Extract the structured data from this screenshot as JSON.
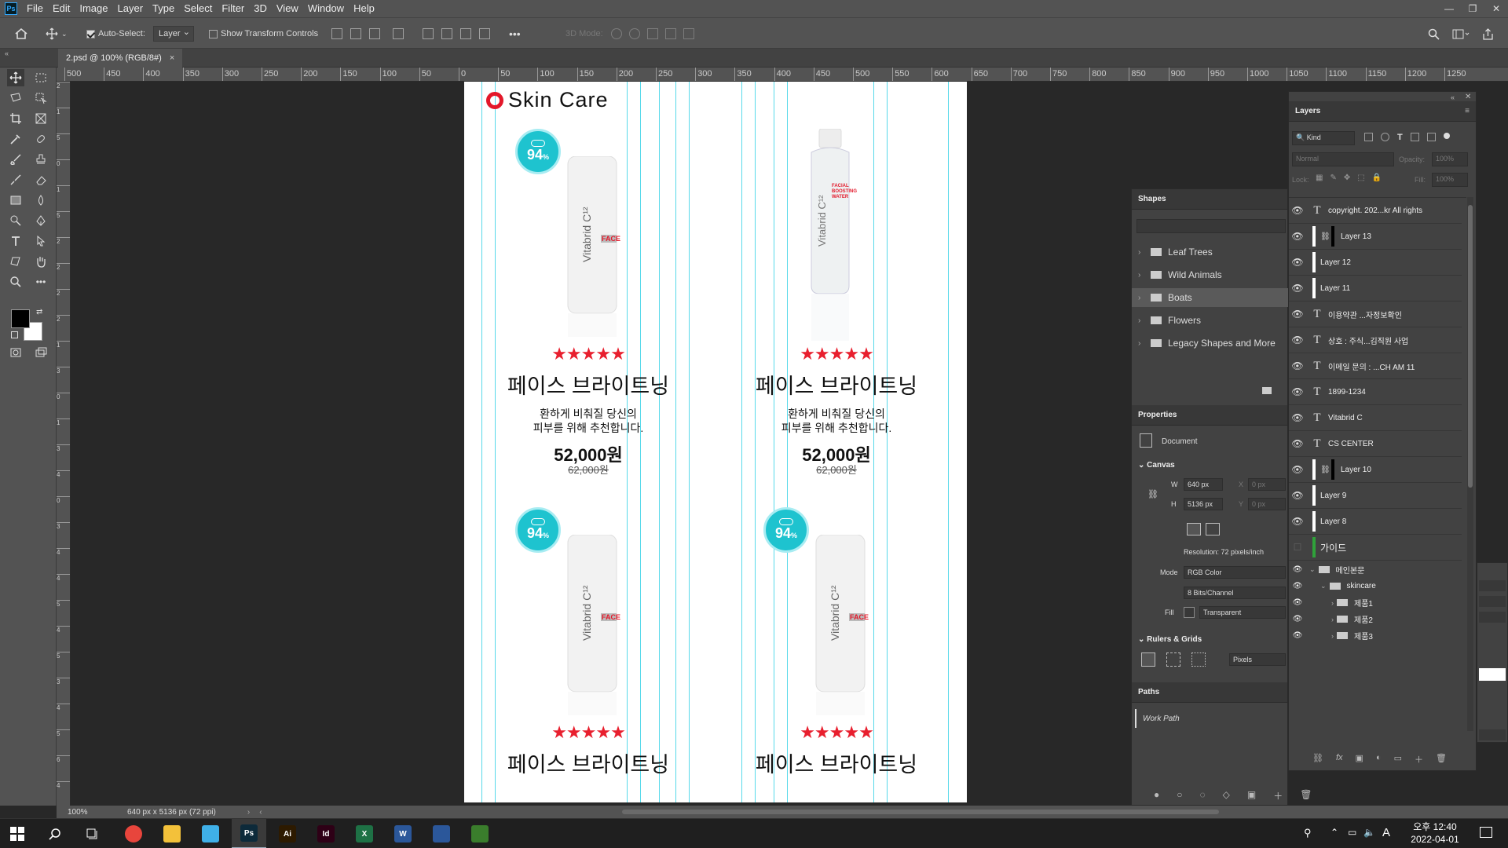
{
  "menu": [
    "File",
    "Edit",
    "Image",
    "Layer",
    "Type",
    "Select",
    "Filter",
    "3D",
    "View",
    "Window",
    "Help"
  ],
  "app_logo": "Ps",
  "options": {
    "auto_select_label": "Auto-Select:",
    "layer_select": "Layer",
    "show_transform_label": "Show Transform Controls",
    "mode_3d_label": "3D Mode:"
  },
  "doc_tab": {
    "title": "2.psd @ 100% (RGB/8#)",
    "close": "×"
  },
  "ruler_h": [
    "500",
    "450",
    "400",
    "350",
    "300",
    "250",
    "200",
    "150",
    "100",
    "50",
    "0",
    "50",
    "100",
    "150",
    "200",
    "250",
    "300",
    "350",
    "400",
    "450",
    "500",
    "550",
    "600",
    "650",
    "700",
    "750",
    "800",
    "850",
    "900",
    "950",
    "1000",
    "1050",
    "1100",
    "1150",
    "1200",
    "1250"
  ],
  "ruler_v": [
    "2",
    "1",
    "5",
    "0",
    "1",
    "5",
    "2",
    "2",
    "2",
    "2",
    "1",
    "3",
    "0",
    "1",
    "3",
    "4",
    "0",
    "3",
    "4",
    "4",
    "5",
    "4",
    "5",
    "3",
    "4",
    "5",
    "6",
    "4"
  ],
  "document": {
    "brand": "Skin Care",
    "products": [
      {
        "badge_num": "94",
        "badge_unit": "%",
        "label": "FACE",
        "stars": "★★★★★",
        "name": "페이스 브라이트닝",
        "desc1": "환하게 비춰질 당신의",
        "desc2": "피부를 위해 추천합니다.",
        "price": "52,000원",
        "old_price": "62,000원"
      },
      {
        "badge_num": "",
        "badge_unit": "",
        "label": "FACIAL BOOSTING WATER",
        "stars": "★★★★★",
        "name": "페이스 브라이트닝",
        "desc1": "환하게 비춰질 당신의",
        "desc2": "피부를 위해 추천합니다.",
        "price": "52,000원",
        "old_price": "62,000원"
      },
      {
        "badge_num": "94",
        "badge_unit": "%",
        "label": "FACE",
        "stars": "★★★★★",
        "name": "페이스 브라이트닝",
        "desc1": "",
        "desc2": "",
        "price": "",
        "old_price": ""
      },
      {
        "badge_num": "94",
        "badge_unit": "%",
        "label": "FACE",
        "stars": "★★★★★",
        "name": "페이스 브라이트닝",
        "desc1": "",
        "desc2": "",
        "price": "",
        "old_price": ""
      }
    ],
    "bottle_brand": "Vitabrid C¹²"
  },
  "shapes_panel": {
    "title": "Shapes",
    "folders": [
      "Leaf Trees",
      "Wild Animals",
      "Boats",
      "Flowers",
      "Legacy Shapes and More"
    ]
  },
  "properties_panel": {
    "title": "Properties",
    "doc_label": "Document",
    "canvas_label": "Canvas",
    "w_label": "W",
    "w_value": "640 px",
    "h_label": "H",
    "h_value": "5136 px",
    "x_label": "X",
    "x_value": "0 px",
    "y_label": "Y",
    "y_value": "0 px",
    "resolution": "Resolution: 72 pixels/inch",
    "mode_label": "Mode",
    "mode_value": "RGB Color",
    "bits_value": "8 Bits/Channel",
    "fill_label": "Fill",
    "fill_value": "Transparent",
    "rulers_label": "Rulers & Grids",
    "units_value": "Pixels"
  },
  "paths_panel": {
    "title": "Paths",
    "work_path": "Work Path"
  },
  "layers_panel": {
    "title": "Layers",
    "kind_label": "Kind",
    "blend_mode": "Normal",
    "opacity_label": "Opacity:",
    "opacity_value": "100%",
    "lock_label": "Lock:",
    "fill_label": "Fill:",
    "fill_value": "100%",
    "layers": [
      {
        "type": "text",
        "name": "copyright. 202...kr All rights"
      },
      {
        "type": "linked",
        "name": "Layer 13"
      },
      {
        "type": "pixel",
        "name": "Layer 12"
      },
      {
        "type": "pixel",
        "name": "Layer 11"
      },
      {
        "type": "text",
        "name": "이용약관 ...자정보확인"
      },
      {
        "type": "text",
        "name": "상호 : 주식...김직원 사업"
      },
      {
        "type": "text",
        "name": "이메일 문의 : ...CH AM 11"
      },
      {
        "type": "text",
        "name": "1899-1234"
      },
      {
        "type": "text",
        "name": "Vitabrid C"
      },
      {
        "type": "text",
        "name": "CS CENTER"
      },
      {
        "type": "linked",
        "name": "Layer 10"
      },
      {
        "type": "pixel",
        "name": "Layer 9"
      },
      {
        "type": "pixel",
        "name": "Layer 8"
      },
      {
        "type": "guide",
        "name": "가이드"
      }
    ],
    "groups": [
      {
        "name": "메인본문",
        "indent": 0
      },
      {
        "name": "skincare",
        "indent": 1
      },
      {
        "name": "제품1",
        "indent": 2
      },
      {
        "name": "제품2",
        "indent": 2
      },
      {
        "name": "제품3",
        "indent": 2
      }
    ]
  },
  "status": {
    "zoom": "100%",
    "doc_info": "640 px x 5136 px (72 ppi)"
  },
  "taskbar": {
    "apps": [
      {
        "name": "Chrome",
        "color": "#e8453c",
        "label": ""
      },
      {
        "name": "Explorer",
        "color": "#f3c13a",
        "label": ""
      },
      {
        "name": "Bird",
        "color": "#3fb0e8",
        "label": ""
      },
      {
        "name": "Photoshop",
        "color": "#0d2a3a",
        "label": "Ps"
      },
      {
        "name": "Illustrator",
        "color": "#2d1a00",
        "label": "Ai"
      },
      {
        "name": "InDesign",
        "color": "#2e0016",
        "label": "Id"
      },
      {
        "name": "Excel",
        "color": "#1e7145",
        "label": "X"
      },
      {
        "name": "Word",
        "color": "#2b579a",
        "label": "W"
      },
      {
        "name": "Notepad",
        "color": "#2b579a",
        "label": ""
      },
      {
        "name": "Chart",
        "color": "#3a7d2c",
        "label": ""
      }
    ],
    "clock_time": "오후 12:40",
    "clock_date": "2022-04-01",
    "ime": "A"
  },
  "colors": {
    "accent_red": "#e3182a",
    "teal": "#1ec3cf",
    "guide": "#3ad2e6",
    "ps_blue": "#31a8ff"
  }
}
